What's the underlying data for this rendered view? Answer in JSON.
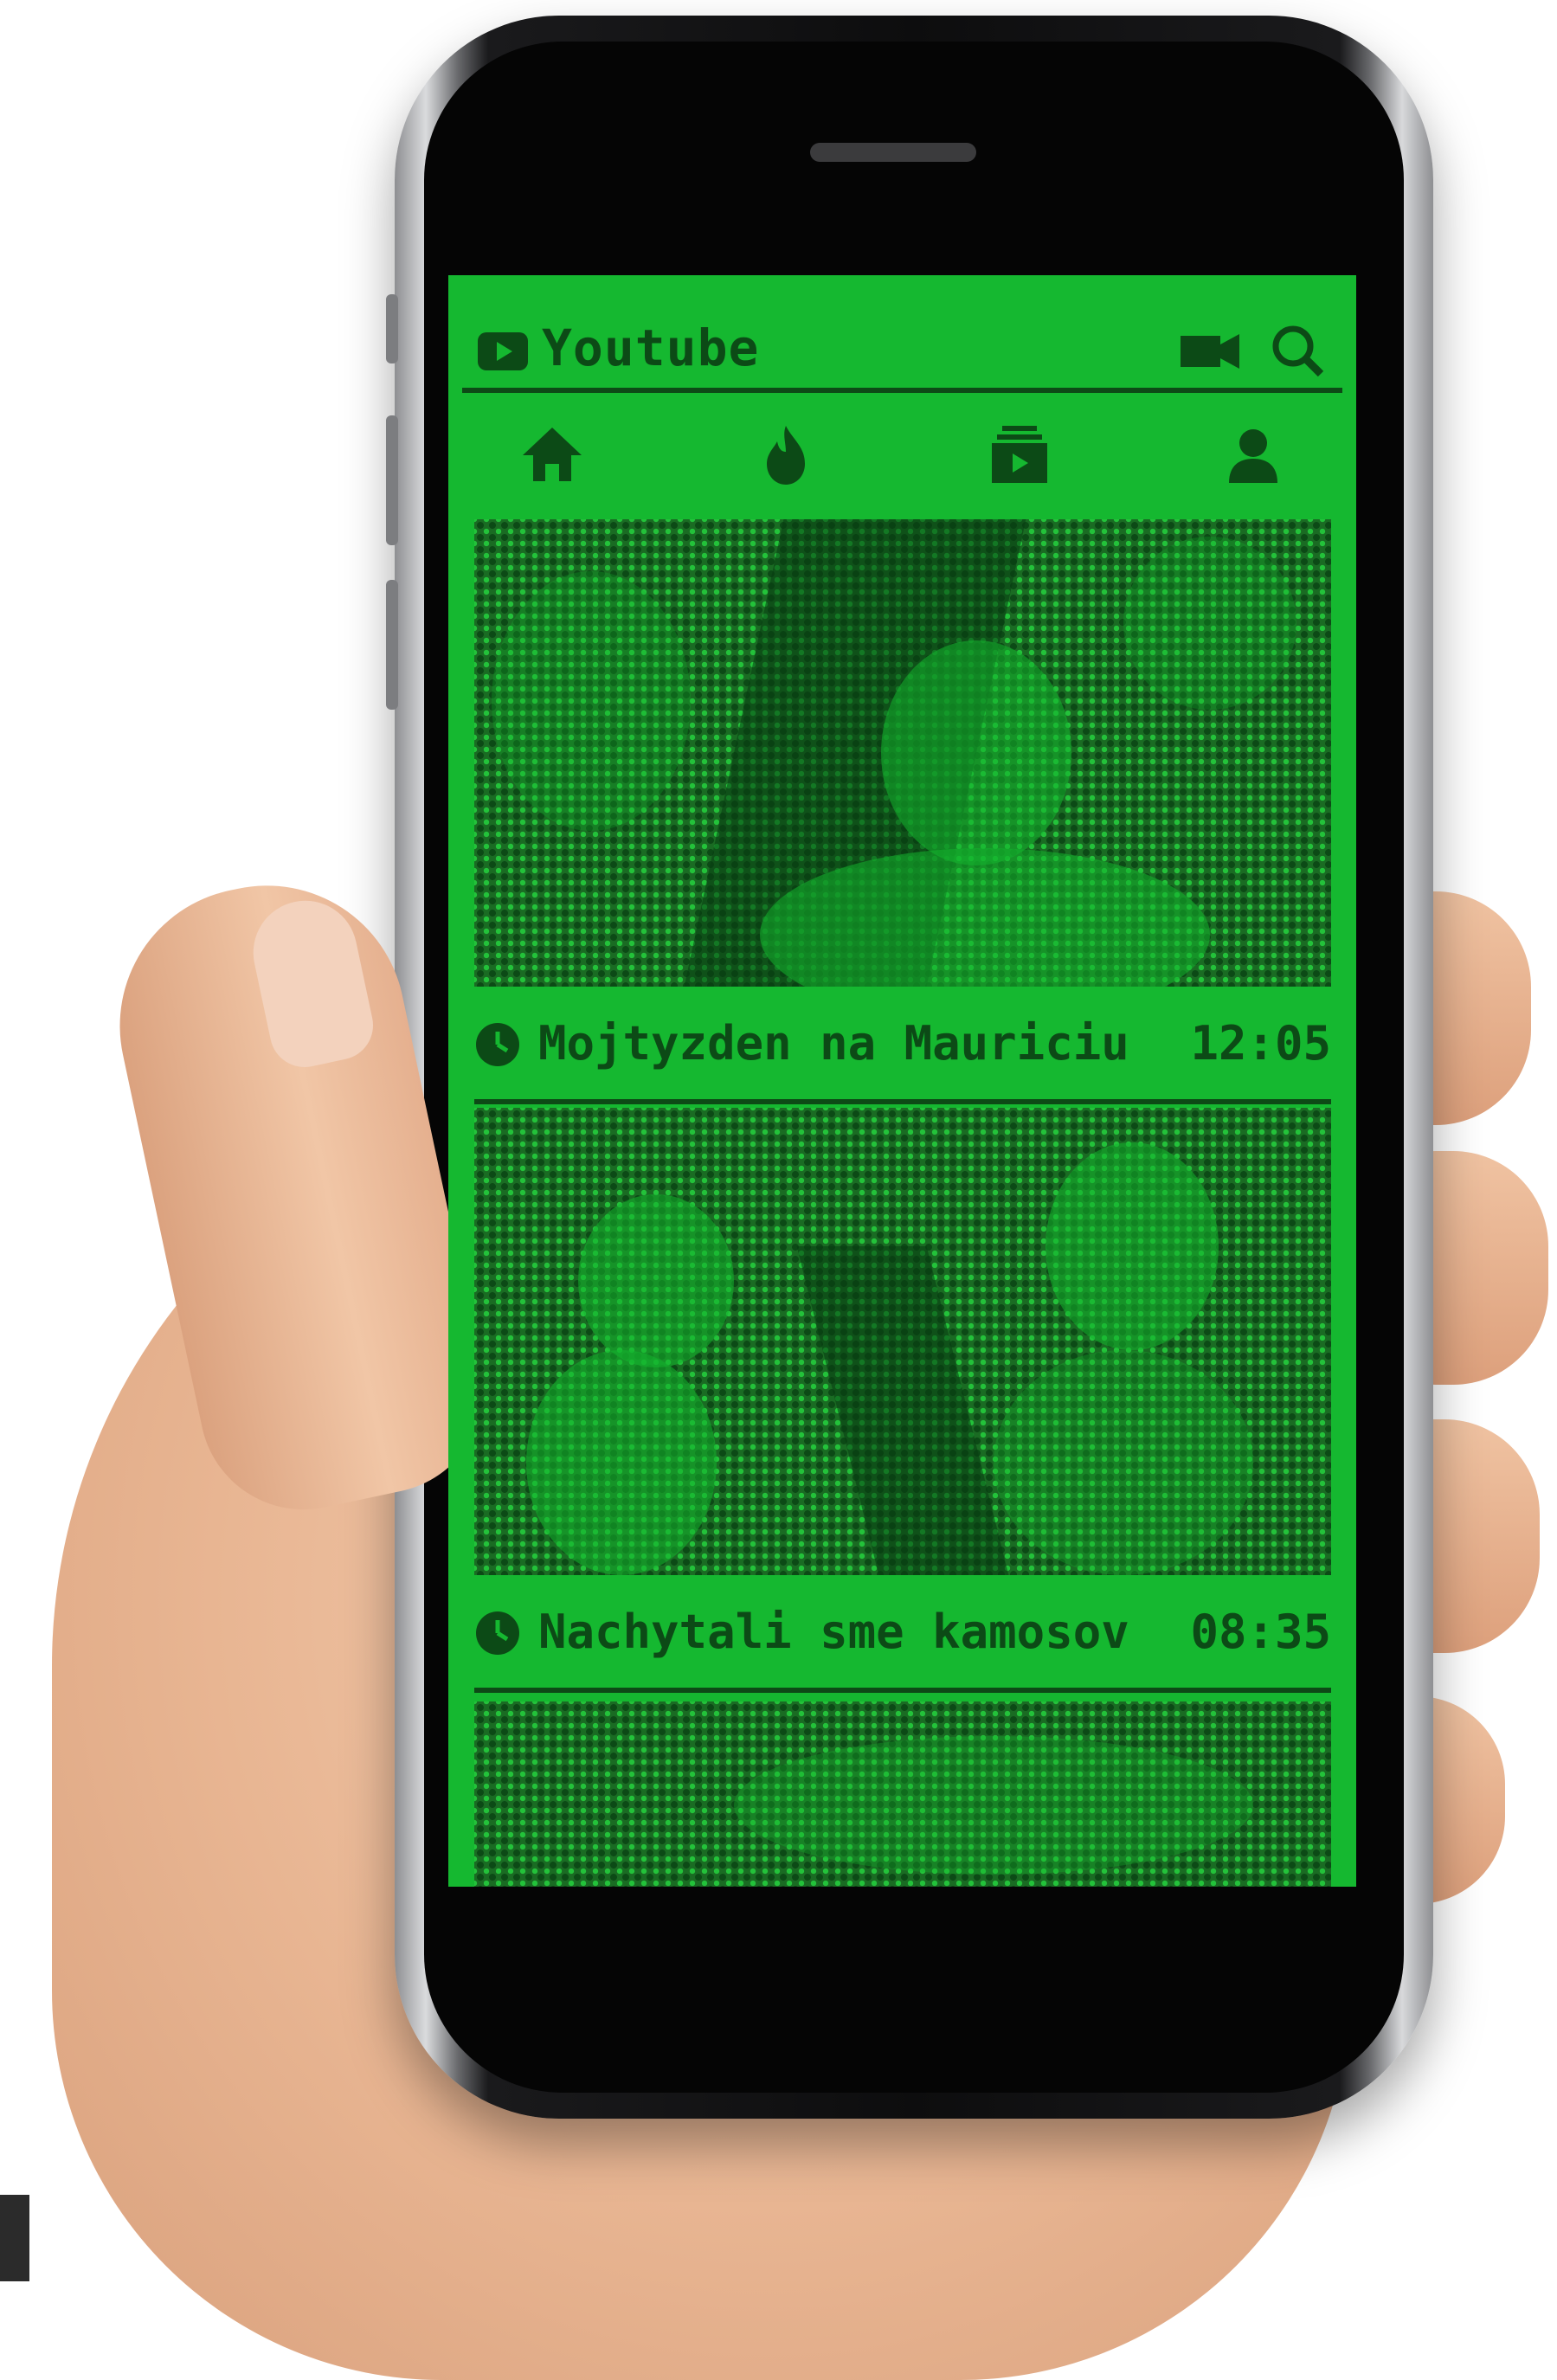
{
  "app": {
    "title": "Youtube",
    "accent_color": "#15b830",
    "ink_color": "#0c4a16",
    "header_icons": [
      "camera-icon",
      "search-icon"
    ]
  },
  "nav": {
    "items": [
      {
        "name": "home",
        "icon": "home-icon"
      },
      {
        "name": "trending",
        "icon": "flame-icon"
      },
      {
        "name": "subscriptions",
        "icon": "subscriptions-icon"
      },
      {
        "name": "account",
        "icon": "account-icon"
      }
    ]
  },
  "videos": [
    {
      "title": "Mojtyzden na Mauriciu",
      "duration": "12:05"
    },
    {
      "title": "Nachytali sme kamosov",
      "duration": "08:35"
    }
  ]
}
